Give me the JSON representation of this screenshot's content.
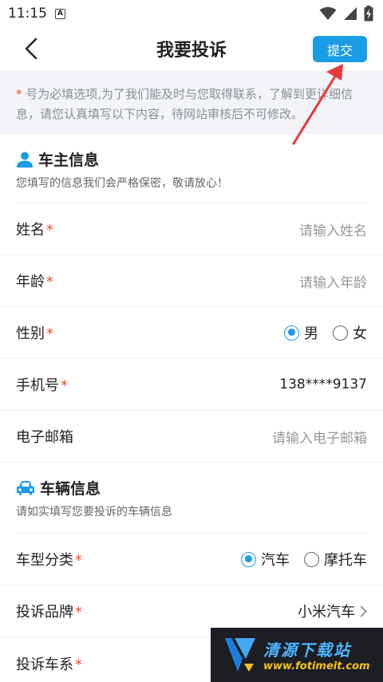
{
  "status_bar": {
    "time": "11:15",
    "notif_letter": "A"
  },
  "nav": {
    "title": "我要投诉",
    "submit_label": "提交"
  },
  "notice": {
    "star": "*",
    "text": " 号为必填选项,为了我们能及时与您取得联系，了解到更详细信息，请您认真填写以下内容，待网站审核后不可修改。"
  },
  "owner_section": {
    "title": "车主信息",
    "subtitle": "您填写的信息我们会严格保密，敬请放心！"
  },
  "fields": {
    "name": {
      "label": "姓名",
      "req": "*",
      "placeholder": "请输入姓名"
    },
    "age": {
      "label": "年龄",
      "req": "*",
      "placeholder": "请输入年龄"
    },
    "gender": {
      "label": "性别",
      "req": "*",
      "option_male": "男",
      "option_female": "女",
      "selected": "男"
    },
    "phone": {
      "label": "手机号",
      "req": "*",
      "value": "138****9137"
    },
    "email": {
      "label": "电子邮箱",
      "placeholder": "请输入电子邮箱"
    }
  },
  "vehicle_section": {
    "title": "车辆信息",
    "subtitle": "请如实填写您要投诉的车辆信息"
  },
  "vehicle_fields": {
    "type": {
      "label": "车型分类",
      "req": "*",
      "option_car": "汽车",
      "option_moto": "摩托车",
      "selected": "汽车"
    },
    "brand": {
      "label": "投诉品牌",
      "req": "*",
      "value": "小米汽车"
    },
    "series": {
      "label": "投诉车系",
      "req": "*"
    }
  },
  "watermark": {
    "cn": "清源下载站",
    "url": "www.fotimeit.com"
  },
  "colors": {
    "accent": "#1b9ce6",
    "required": "#e8502d",
    "annotation": "#e8373d"
  }
}
